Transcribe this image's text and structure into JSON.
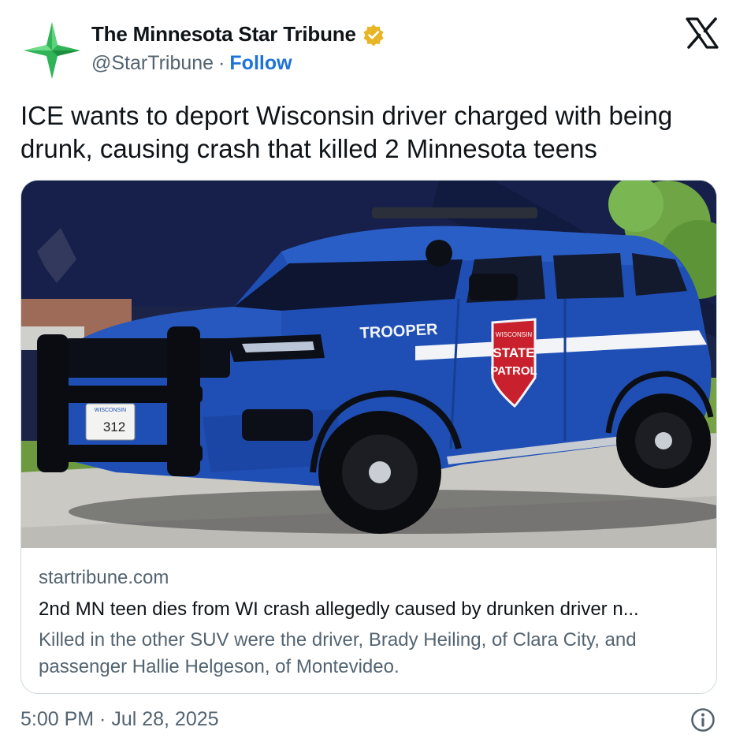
{
  "author": {
    "name": "The Minnesota Star Tribune",
    "handle": "@StarTribune",
    "separator": "·",
    "follow_label": "Follow",
    "avatar_icon": "star-logo-icon",
    "verified_icon": "gold-verified-badge-icon"
  },
  "platform_icon": "x-logo-icon",
  "tweet_text": "ICE wants to deport Wisconsin driver charged with being drunk, causing crash that killed 2 Minnesota teens",
  "card": {
    "image_icon": "state-patrol-suv-photo",
    "vehicle_text": "TROOPER",
    "badge_line1": "WISCONSIN",
    "badge_line2": "STATE",
    "badge_line3": "PATROL",
    "plate_state": "WISCONSIN",
    "plate_number": "312",
    "domain": "startribune.com",
    "title": "2nd MN teen dies from WI crash allegedly caused by drunken driver n...",
    "description": "Killed in the other SUV were the driver, Brady Heiling, of Clara City, and passenger Hallie Helgeson, of Montevideo."
  },
  "timestamp": "5:00 PM · Jul 28, 2025",
  "info_icon": "info-icon",
  "colors": {
    "follow": "#1d72d8",
    "secondary_text": "#536471",
    "border": "#cfd9de",
    "suv_blue": "#1f4fb5"
  }
}
